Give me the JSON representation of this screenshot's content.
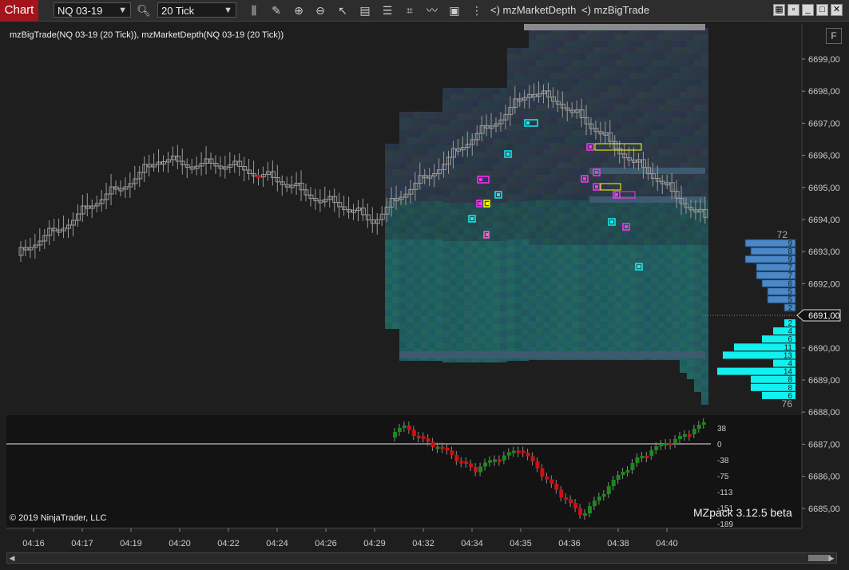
{
  "toolbar": {
    "chart_tab": "Chart",
    "instrument": "NQ 03-19",
    "interval": "20 Tick",
    "indicators": [
      "mzMarketDepth",
      "mzBigTrade"
    ]
  },
  "chart": {
    "title": "mzBigTrade(NQ 03-19 (20 Tick)), mzMarketDepth(NQ 03-19 (20 Tick))",
    "copyright": "© 2019 NinjaTrader, LLC",
    "watermark": "MZpack 3.12.5 beta",
    "current_price": "6691,00",
    "price_labels": [
      "6699,00",
      "6698,00",
      "6697,00",
      "6696,00",
      "6695,00",
      "6694,00",
      "6693,00",
      "6692,00",
      "6691,00",
      "6690,00",
      "6689,00",
      "6688,00",
      "6687,00",
      "6686,00",
      "6685,00"
    ],
    "time_labels": [
      "04:16",
      "04:17",
      "04:19",
      "04:20",
      "04:22",
      "04:24",
      "04:26",
      "04:29",
      "04:32",
      "04:34",
      "04:35",
      "04:36",
      "04:38",
      "04:40"
    ],
    "delta_labels": [
      "38",
      "0",
      "-38",
      "-75",
      "-113",
      "-151",
      "-189"
    ],
    "dom_ask_total": "72",
    "dom_bid_total": "76",
    "dom_ask_sizes": [
      9,
      8,
      9,
      7,
      7,
      6,
      5,
      5,
      2
    ],
    "dom_bid_sizes": [
      2,
      4,
      6,
      11,
      13,
      4,
      14,
      8,
      8,
      6
    ],
    "colors": {
      "background": "#1e1e1e",
      "ask": "#4a88c8",
      "bid": "#12f0f0",
      "down_bar": "#d01010",
      "up_bar": "#1a8a1a",
      "chart_tab": "#a3141b"
    }
  }
}
